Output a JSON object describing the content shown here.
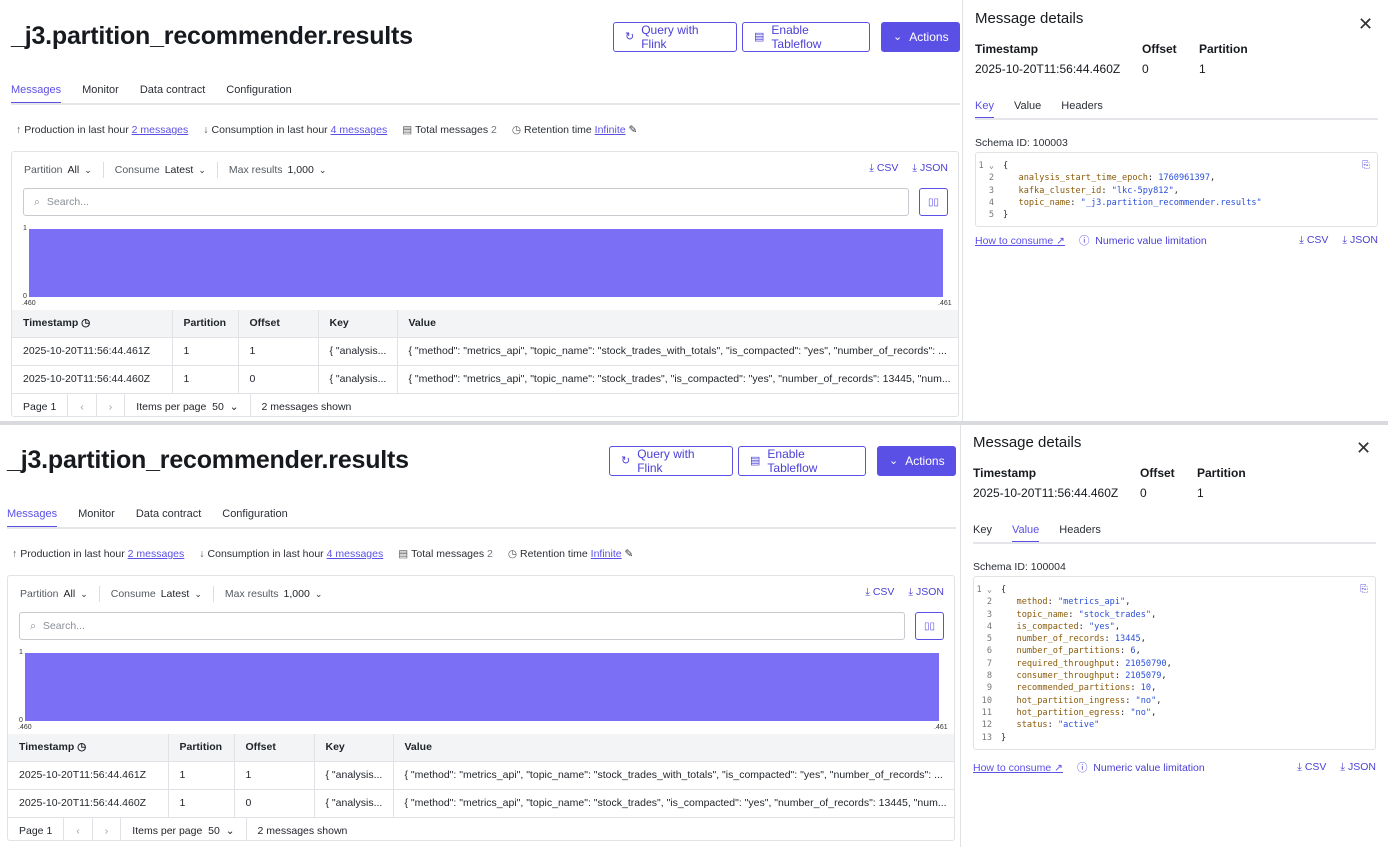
{
  "topic_title": "_j3.partition_recommender.results",
  "buttons": {
    "query_flink": "Query with Flink",
    "enable_tableflow": "Enable Tableflow",
    "actions": "Actions"
  },
  "tabs": [
    "Messages",
    "Monitor",
    "Data contract",
    "Configuration"
  ],
  "stats": {
    "production_label": "Production in last hour",
    "production_value": "2 messages",
    "consumption_label": "Consumption in last hour",
    "consumption_value": "4 messages",
    "total_label": "Total messages",
    "total_value": "2",
    "retention_label": "Retention time",
    "retention_value": "Infinite"
  },
  "filters": {
    "partition_label": "Partition",
    "partition_value": "All",
    "consume_label": "Consume",
    "consume_value": "Latest",
    "max_label": "Max results",
    "max_value": "1,000",
    "csv": "CSV",
    "json": "JSON"
  },
  "search": {
    "placeholder": "Search..."
  },
  "histogram": {
    "y_max": "1",
    "y_min": "0",
    "x_start": ".460",
    "x_end": ".461",
    "fill": 1.0,
    "color": "#7b6ff6"
  },
  "table": {
    "headers": [
      "Timestamp",
      "Partition",
      "Offset",
      "Key",
      "Value"
    ],
    "rows": [
      [
        "2025-10-20T11:56:44.461Z",
        "1",
        "1",
        "{ \"analysis...",
        "{ \"method\": \"metrics_api\", \"topic_name\": \"stock_trades_with_totals\", \"is_compacted\": \"yes\", \"number_of_records\": ..."
      ],
      [
        "2025-10-20T11:56:44.460Z",
        "1",
        "0",
        "{ \"analysis...",
        "{ \"method\": \"metrics_api\", \"topic_name\": \"stock_trades\", \"is_compacted\": \"yes\", \"number_of_records\": 13445, \"num..."
      ]
    ]
  },
  "pager": {
    "page": "Page 1",
    "items_label": "Items per page",
    "items_value": "50",
    "shown": "2 messages shown"
  },
  "details": {
    "title": "Message details",
    "timestamp_label": "Timestamp",
    "timestamp_value": "2025-10-20T11:56:44.460Z",
    "offset_label": "Offset",
    "offset_value": "0",
    "partition_label": "Partition",
    "partition_value": "1",
    "tabs": [
      "Key",
      "Value",
      "Headers"
    ],
    "how_to_consume": "How to consume",
    "numeric_limitation": "Numeric value limitation",
    "csv": "CSV",
    "json": "JSON"
  },
  "key_view": {
    "schema_id": "Schema ID: 100003",
    "lines": [
      [
        "analysis_start_time_epoch",
        "1760961397",
        "num"
      ],
      [
        "kafka_cluster_id",
        "\"lkc-5py812\"",
        "s"
      ],
      [
        "topic_name",
        "\"_j3.partition_recommender.results\"",
        "s"
      ]
    ]
  },
  "value_view": {
    "schema_id": "Schema ID: 100004",
    "lines": [
      [
        "method",
        "\"metrics_api\"",
        "s"
      ],
      [
        "topic_name",
        "\"stock_trades\"",
        "s"
      ],
      [
        "is_compacted",
        "\"yes\"",
        "s"
      ],
      [
        "number_of_records",
        "13445",
        "num"
      ],
      [
        "number_of_partitions",
        "6",
        "num"
      ],
      [
        "required_throughput",
        "21050790",
        "num"
      ],
      [
        "consumer_throughput",
        "2105079",
        "num"
      ],
      [
        "recommended_partitions",
        "10",
        "num"
      ],
      [
        "hot_partition_ingress",
        "\"no\"",
        "s"
      ],
      [
        "hot_partition_egress",
        "\"no\"",
        "s"
      ],
      [
        "status",
        "\"active\"",
        "s"
      ]
    ]
  },
  "colors": {
    "accent": "#5b50e6",
    "histogram": "#7b6ff6"
  }
}
